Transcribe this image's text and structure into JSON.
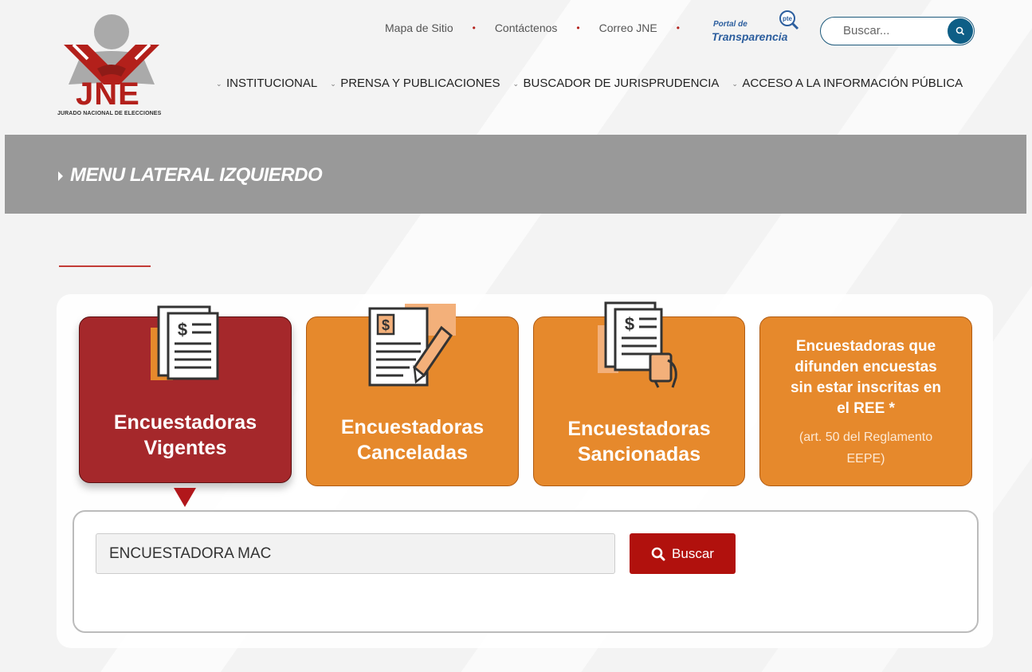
{
  "header": {
    "logo_text": "JNE",
    "logo_subtitle": "JURADO NACIONAL DE ELECCIONES",
    "top_links": [
      "Mapa de Sitio",
      "Contáctenos",
      "Correo JNE"
    ],
    "transparency": {
      "line1": "Portal de",
      "line2": "Transparencia",
      "badge": "pte"
    },
    "search_placeholder": "Buscar...",
    "nav": [
      "INSTITUCIONAL",
      "PRENSA Y PUBLICACIONES",
      "BUSCADOR DE JURISPRUDENCIA",
      "ACCESO A LA INFORMACIÓN PÚBLICA"
    ]
  },
  "banner": {
    "title": "MENU LATERAL IZQUIERDO"
  },
  "cards": [
    {
      "line1": "Encuestadoras",
      "line2": "Vigentes",
      "icon": "document-dollar-icon",
      "active": true
    },
    {
      "line1": "Encuestadoras",
      "line2": "Canceladas",
      "icon": "document-pen-icon",
      "active": false
    },
    {
      "line1": "Encuestadoras",
      "line2": "Sancionadas",
      "icon": "document-hand-icon",
      "active": false
    },
    {
      "title": "Encuestadoras que difunden encuestas sin estar inscritas en el REE *",
      "sub": "(art. 50 del Reglamento EEPE)",
      "active": false
    }
  ],
  "search": {
    "value": "ENCUESTADORA MAC",
    "button_label": "Buscar"
  },
  "colors": {
    "brand_red": "#b3201b",
    "card_orange": "#e6892c",
    "card_active": "#a5282b",
    "banner_gray": "#999999",
    "search_btn": "#b1110d"
  }
}
